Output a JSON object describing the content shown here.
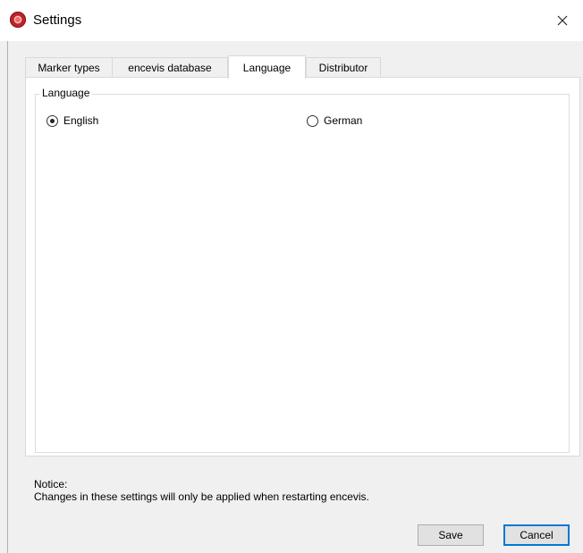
{
  "window": {
    "title": "Settings"
  },
  "tabs": [
    {
      "label": "Marker types"
    },
    {
      "label": "encevis database"
    },
    {
      "label": "Language",
      "active": true
    },
    {
      "label": "Distributor"
    }
  ],
  "language_group": {
    "legend": "Language",
    "options": [
      {
        "label": "English",
        "checked": true
      },
      {
        "label": "German",
        "checked": false
      }
    ]
  },
  "notice": {
    "heading": "Notice:",
    "text": "Changes in these settings will only be applied when restarting encevis."
  },
  "buttons": {
    "save": "Save",
    "cancel": "Cancel"
  },
  "icons": {
    "app": "app-logo-icon",
    "close": "close-icon"
  }
}
